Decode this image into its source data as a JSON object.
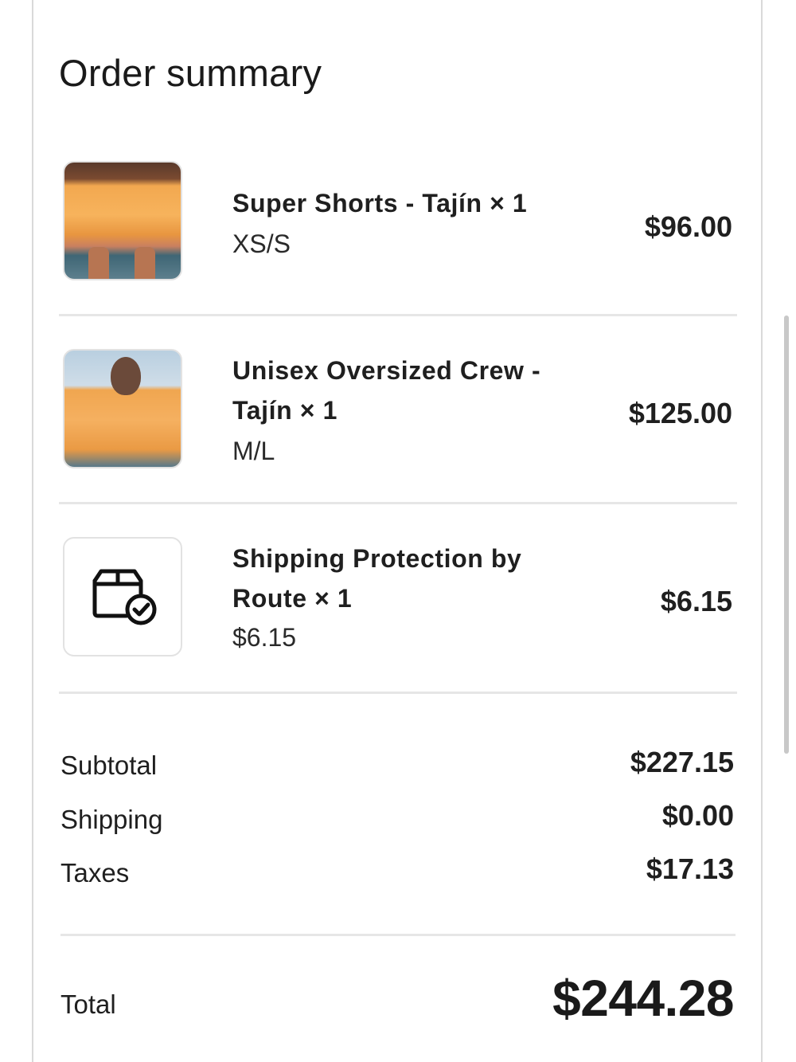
{
  "summary": {
    "title": "Order summary"
  },
  "items": [
    {
      "name": "Super Shorts - Tajín × 1",
      "variant": "XS/S",
      "price": "$96.00"
    },
    {
      "name": "Unisex Oversized Crew - Tajín × 1",
      "variant": "M/L",
      "price": "$125.00"
    },
    {
      "name": "Shipping Protection by Route × 1",
      "variant": "$6.15",
      "price": "$6.15",
      "icon": "package-check-icon"
    }
  ],
  "totals": {
    "subtotal_label": "Subtotal",
    "subtotal_value": "$227.15",
    "shipping_label": "Shipping",
    "shipping_value": "$0.00",
    "taxes_label": "Taxes",
    "taxes_value": "$17.13",
    "total_label": "Total",
    "total_value": "$244.28"
  },
  "colors": {
    "product": "#f5ad55",
    "text": "#1a1a1a",
    "divider": "#e6e6e6"
  }
}
